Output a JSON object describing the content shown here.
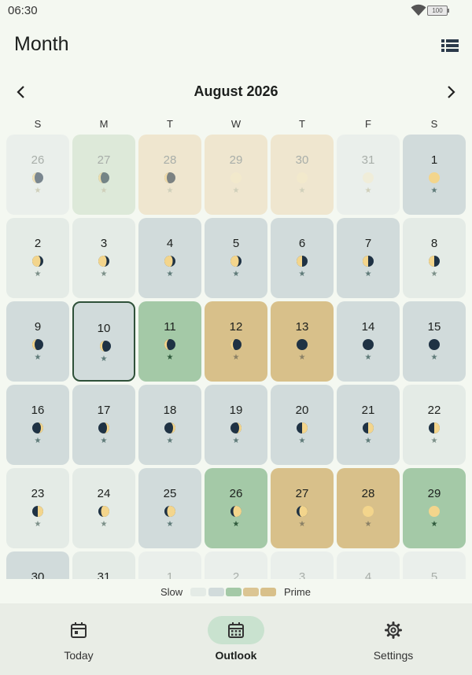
{
  "status_bar": {
    "time": "06:30",
    "battery": "100"
  },
  "header": {
    "title": "Month"
  },
  "calendar": {
    "month_label": "August 2026",
    "weekdays": [
      "S",
      "M",
      "T",
      "W",
      "T",
      "F",
      "S"
    ],
    "weeks": [
      [
        {
          "day": "26",
          "in_month": false,
          "level": "slow",
          "moon": "waning-crescent"
        },
        {
          "day": "27",
          "in_month": false,
          "level": "good",
          "moon": "waning-crescent"
        },
        {
          "day": "28",
          "in_month": false,
          "level": "prime",
          "moon": "waning-crescent"
        },
        {
          "day": "29",
          "in_month": false,
          "level": "prime",
          "moon": "new-light"
        },
        {
          "day": "30",
          "in_month": false,
          "level": "prime",
          "moon": "new-light"
        },
        {
          "day": "31",
          "in_month": false,
          "level": "slow",
          "moon": "new-light"
        },
        {
          "day": "1",
          "in_month": true,
          "level": "low",
          "moon": "full"
        }
      ],
      [
        {
          "day": "2",
          "in_month": true,
          "level": "slow",
          "moon": "waning-gibbous"
        },
        {
          "day": "3",
          "in_month": true,
          "level": "slow",
          "moon": "waning-gibbous"
        },
        {
          "day": "4",
          "in_month": true,
          "level": "low",
          "moon": "waning-gibbous"
        },
        {
          "day": "5",
          "in_month": true,
          "level": "low",
          "moon": "waning-gibbous"
        },
        {
          "day": "6",
          "in_month": true,
          "level": "low",
          "moon": "last-quarter"
        },
        {
          "day": "7",
          "in_month": true,
          "level": "low",
          "moon": "last-quarter"
        },
        {
          "day": "8",
          "in_month": true,
          "level": "slow",
          "moon": "last-quarter"
        }
      ],
      [
        {
          "day": "9",
          "in_month": true,
          "level": "low",
          "moon": "waning-crescent"
        },
        {
          "day": "10",
          "in_month": true,
          "level": "low",
          "moon": "waning-crescent",
          "selected": true
        },
        {
          "day": "11",
          "in_month": true,
          "level": "good",
          "moon": "waning-crescent"
        },
        {
          "day": "12",
          "in_month": true,
          "level": "prime",
          "moon": "waning-crescent"
        },
        {
          "day": "13",
          "in_month": true,
          "level": "prime",
          "moon": "new"
        },
        {
          "day": "14",
          "in_month": true,
          "level": "low",
          "moon": "new"
        },
        {
          "day": "15",
          "in_month": true,
          "level": "low",
          "moon": "new"
        }
      ],
      [
        {
          "day": "16",
          "in_month": true,
          "level": "low",
          "moon": "waxing-crescent"
        },
        {
          "day": "17",
          "in_month": true,
          "level": "low",
          "moon": "waxing-crescent"
        },
        {
          "day": "18",
          "in_month": true,
          "level": "low",
          "moon": "waxing-crescent"
        },
        {
          "day": "19",
          "in_month": true,
          "level": "low",
          "moon": "waxing-crescent"
        },
        {
          "day": "20",
          "in_month": true,
          "level": "low",
          "moon": "first-quarter"
        },
        {
          "day": "21",
          "in_month": true,
          "level": "low",
          "moon": "first-quarter"
        },
        {
          "day": "22",
          "in_month": true,
          "level": "slow",
          "moon": "first-quarter"
        }
      ],
      [
        {
          "day": "23",
          "in_month": true,
          "level": "slow",
          "moon": "first-quarter"
        },
        {
          "day": "24",
          "in_month": true,
          "level": "slow",
          "moon": "waxing-gibbous"
        },
        {
          "day": "25",
          "in_month": true,
          "level": "low",
          "moon": "waxing-gibbous"
        },
        {
          "day": "26",
          "in_month": true,
          "level": "good",
          "moon": "waxing-gibbous"
        },
        {
          "day": "27",
          "in_month": true,
          "level": "prime",
          "moon": "waxing-gibbous"
        },
        {
          "day": "28",
          "in_month": true,
          "level": "prime",
          "moon": "full"
        },
        {
          "day": "29",
          "in_month": true,
          "level": "good",
          "moon": "full"
        }
      ],
      [
        {
          "day": "30",
          "in_month": true,
          "level": "low",
          "moon": "full"
        },
        {
          "day": "31",
          "in_month": true,
          "level": "slow",
          "moon": "full"
        },
        {
          "day": "1",
          "in_month": false,
          "level": "slow",
          "moon": "full"
        },
        {
          "day": "2",
          "in_month": false,
          "level": "slow",
          "moon": "full"
        },
        {
          "day": "3",
          "in_month": false,
          "level": "slow",
          "moon": "full"
        },
        {
          "day": "4",
          "in_month": false,
          "level": "slow",
          "moon": "full"
        },
        {
          "day": "5",
          "in_month": false,
          "level": "slow",
          "moon": "full"
        }
      ]
    ]
  },
  "legend": {
    "slow_label": "Slow",
    "prime_label": "Prime",
    "colors": {
      "slow": "#e4ebe6",
      "low": "#d1dbdb",
      "good": "#a4c9a7",
      "fair": "#dbc593",
      "prime": "#d8c08a"
    }
  },
  "bottom_nav": {
    "tabs": [
      {
        "label": "Today",
        "icon": "calendar-today-icon",
        "active": false
      },
      {
        "label": "Outlook",
        "icon": "calendar-month-icon",
        "active": true
      },
      {
        "label": "Settings",
        "icon": "gear-icon",
        "active": false
      }
    ]
  }
}
